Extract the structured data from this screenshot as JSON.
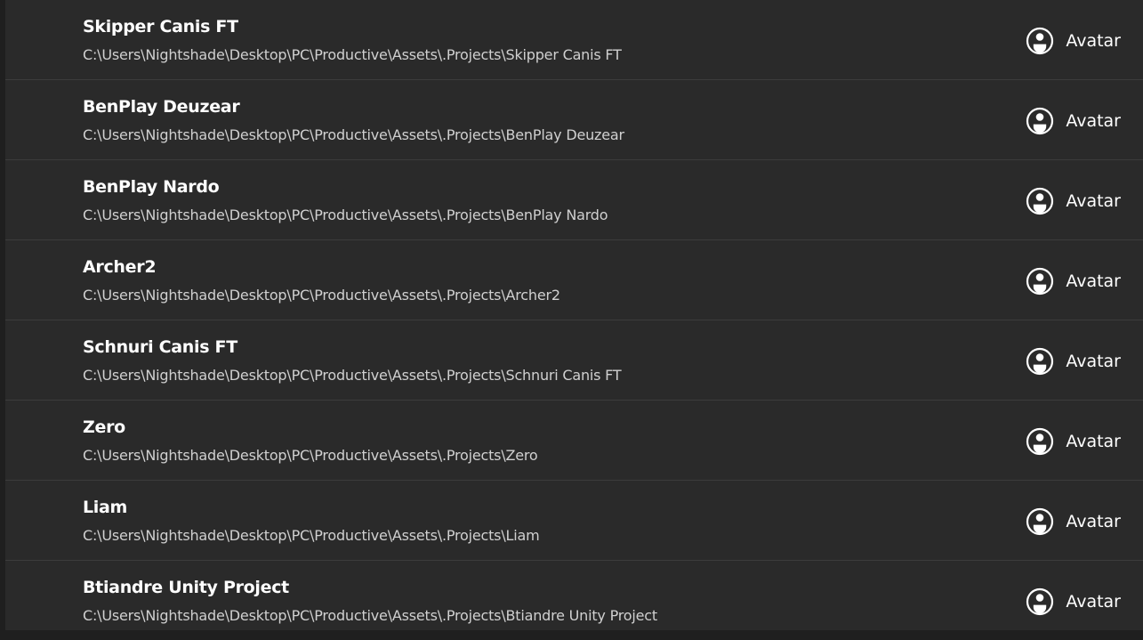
{
  "projects": [
    {
      "name": "Skipper Canis FT",
      "path": "C:\\Users\\Nightshade\\Desktop\\PC\\Productive\\Assets\\.Projects\\Skipper Canis FT",
      "type_label": "Avatar",
      "type_icon": "avatar-icon"
    },
    {
      "name": "BenPlay Deuzear",
      "path": "C:\\Users\\Nightshade\\Desktop\\PC\\Productive\\Assets\\.Projects\\BenPlay Deuzear",
      "type_label": "Avatar",
      "type_icon": "avatar-icon"
    },
    {
      "name": "BenPlay Nardo",
      "path": "C:\\Users\\Nightshade\\Desktop\\PC\\Productive\\Assets\\.Projects\\BenPlay Nardo",
      "type_label": "Avatar",
      "type_icon": "avatar-icon"
    },
    {
      "name": "Archer2",
      "path": "C:\\Users\\Nightshade\\Desktop\\PC\\Productive\\Assets\\.Projects\\Archer2",
      "type_label": "Avatar",
      "type_icon": "avatar-icon"
    },
    {
      "name": "Schnuri Canis FT",
      "path": "C:\\Users\\Nightshade\\Desktop\\PC\\Productive\\Assets\\.Projects\\Schnuri Canis FT",
      "type_label": "Avatar",
      "type_icon": "avatar-icon"
    },
    {
      "name": "Zero",
      "path": "C:\\Users\\Nightshade\\Desktop\\PC\\Productive\\Assets\\.Projects\\Zero",
      "type_label": "Avatar",
      "type_icon": "avatar-icon"
    },
    {
      "name": "Liam",
      "path": "C:\\Users\\Nightshade\\Desktop\\PC\\Productive\\Assets\\.Projects\\Liam",
      "type_label": "Avatar",
      "type_icon": "avatar-icon"
    },
    {
      "name": "Btiandre Unity Project",
      "path": "C:\\Users\\Nightshade\\Desktop\\PC\\Productive\\Assets\\.Projects\\Btiandre Unity Project",
      "type_label": "Avatar",
      "type_icon": "avatar-icon"
    }
  ],
  "colors": {
    "background": "#2a2a2a",
    "divider": "#3c3c3c",
    "title_text": "#ffffff",
    "path_text": "#d0d0d0"
  }
}
